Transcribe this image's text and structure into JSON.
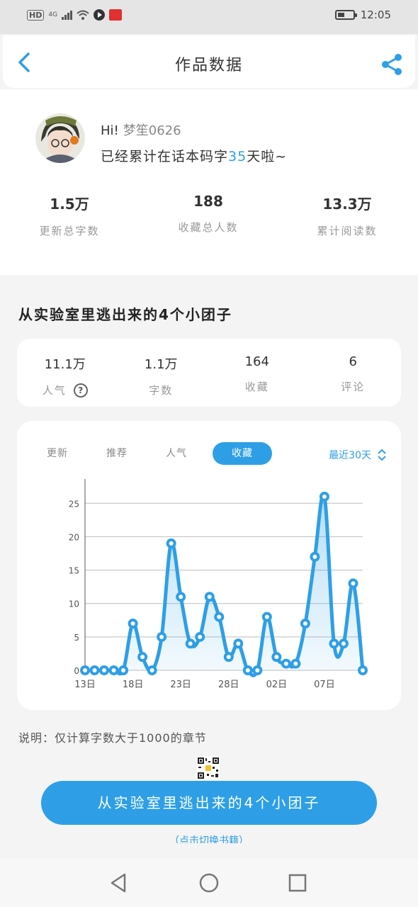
{
  "status_bar": {
    "hd": "HD",
    "network": "4G",
    "time": "12:05"
  },
  "header": {
    "title": "作品数据"
  },
  "profile": {
    "greeting": "Hi!",
    "username": "梦笙0626",
    "days_prefix": "已经累计在话本码字",
    "days": "35",
    "days_suffix": "天啦~"
  },
  "totals": [
    {
      "value": "1.5万",
      "label": "更新总字数"
    },
    {
      "value": "188",
      "label": "收藏总人数"
    },
    {
      "value": "13.3万",
      "label": "累计阅读数"
    }
  ],
  "work": {
    "title": "从实验室里逃出来的4个小团子",
    "stats": [
      {
        "value": "11.1万",
        "label": "人气"
      },
      {
        "value": "1.1万",
        "label": "字数"
      },
      {
        "value": "164",
        "label": "收藏"
      },
      {
        "value": "6",
        "label": "评论"
      }
    ]
  },
  "chart_tabs": [
    {
      "label": "更新",
      "active": false
    },
    {
      "label": "推荐",
      "active": false
    },
    {
      "label": "人气",
      "active": false
    },
    {
      "label": "收藏",
      "active": true
    }
  ],
  "range_label": "最近30天",
  "chart_data": {
    "type": "line",
    "x": [
      "13日",
      "14日",
      "15日",
      "16日",
      "17日",
      "18日",
      "19日",
      "20日",
      "21日",
      "22日",
      "23日",
      "24日",
      "25日",
      "26日",
      "27日",
      "28日",
      "29日",
      "30日",
      "31日",
      "01日",
      "02日",
      "03日",
      "04日",
      "05日",
      "06日",
      "07日",
      "08日",
      "09日",
      "10日",
      "11日"
    ],
    "x_tick_labels": [
      "13日",
      "18日",
      "23日",
      "28日",
      "02日",
      "07日"
    ],
    "values": [
      0,
      0,
      0,
      0,
      0,
      7,
      2,
      0,
      5,
      19,
      11,
      4,
      5,
      11,
      8,
      2,
      4,
      0,
      0,
      8,
      2,
      1,
      1,
      7,
      17,
      26,
      4,
      4,
      13,
      0
    ],
    "yticks": [
      0,
      5,
      10,
      15,
      20,
      25
    ],
    "ylim": [
      0,
      28
    ],
    "grid": true,
    "color": "#2e9fe6"
  },
  "note": "说明：仅计算字数大于1000的章节",
  "button_label": "从实验室里逃出来的4个小团子",
  "sub_link": "（点击切换书籍）",
  "colors": {
    "accent": "#2e9fe6",
    "background": "#f4f4f4"
  },
  "icons": {
    "back": "chevron-left-icon",
    "share": "share-icon",
    "help": "question-circle-icon",
    "range": "up-down-chevron-icon"
  }
}
